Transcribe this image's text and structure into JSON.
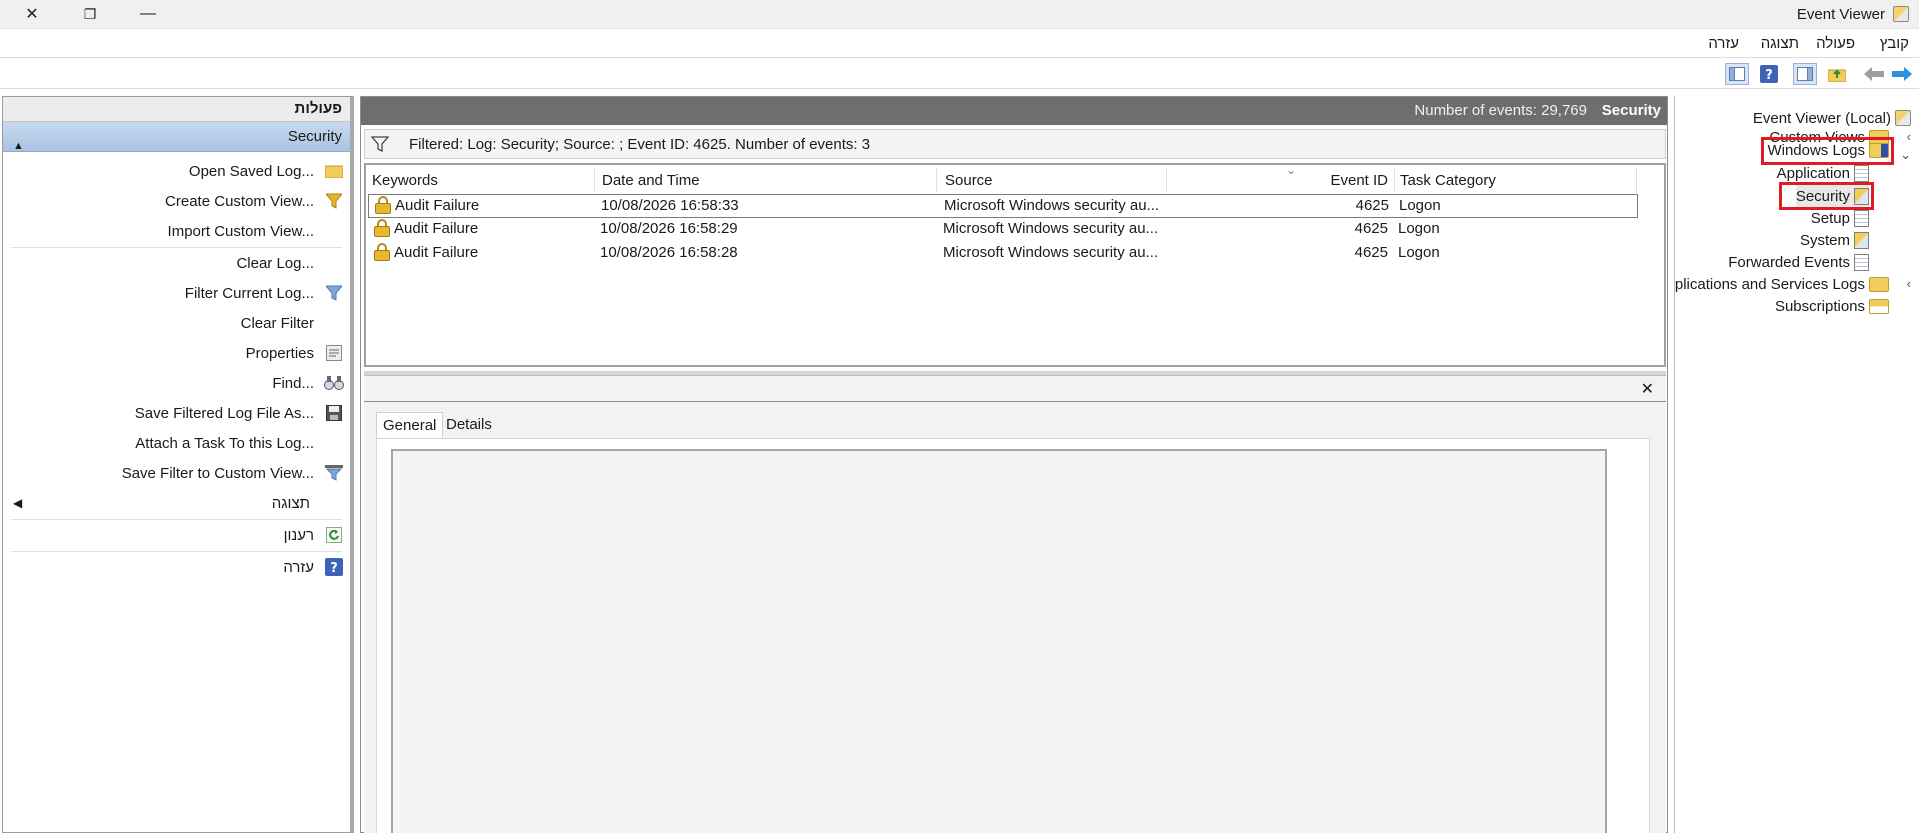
{
  "window": {
    "title": "Event Viewer",
    "close_symbol": "✕",
    "restore_symbol": "❐",
    "minimize_symbol": "—"
  },
  "menu": {
    "items": [
      "קובץ",
      "פעולה",
      "תצוגה",
      "עזרה"
    ]
  },
  "toolbar": {
    "forward_icon": "arrow-right-icon",
    "back_icon": "arrow-left-icon"
  },
  "actions_pane": {
    "header": "פעולות",
    "section_title": "Security",
    "items": [
      {
        "label": "Open Saved Log...",
        "icon": "folder-open-icon",
        "glyph": "📂"
      },
      {
        "label": "Create Custom View...",
        "icon": "filter-icon",
        "glyph": "▼"
      },
      {
        "label": "Import Custom View...",
        "icon": "",
        "glyph": ""
      },
      {
        "label": "Clear Log...",
        "icon": "",
        "glyph": ""
      },
      {
        "label": "Filter Current Log...",
        "icon": "filter-icon",
        "glyph": "▼"
      },
      {
        "label": "Clear Filter",
        "icon": "",
        "glyph": ""
      },
      {
        "label": "Properties",
        "icon": "properties-icon",
        "glyph": "▤"
      },
      {
        "label": "Find...",
        "icon": "binoculars-icon",
        "glyph": "⌕"
      },
      {
        "label": "Save Filtered Log File As...",
        "icon": "save-icon",
        "glyph": "🖫"
      },
      {
        "label": "Attach a Task To this Log...",
        "icon": "",
        "glyph": ""
      },
      {
        "label": "Save Filter to Custom View...",
        "icon": "filter-save-icon",
        "glyph": "⏷"
      }
    ],
    "view_item": "תצוגה",
    "refresh_item": "רענון",
    "help_item": "עזרה"
  },
  "center": {
    "title": "Security",
    "event_count": "Number of events: 29,769",
    "filter_text": "Filtered: Log: Security; Source: ; Event ID: 4625. Number of events: 3",
    "columns": [
      "Keywords",
      "Date and Time",
      "Source",
      "Event ID",
      "Task Category"
    ],
    "rows": [
      {
        "keywords": "Audit Failure",
        "datetime": "10/08/2026 16:58:33",
        "source": "Microsoft Windows security au...",
        "event_id": "4625",
        "task_category": "Logon"
      },
      {
        "keywords": "Audit Failure",
        "datetime": "10/08/2026 16:58:29",
        "source": "Microsoft Windows security au...",
        "event_id": "4625",
        "task_category": "Logon"
      },
      {
        "keywords": "Audit Failure",
        "datetime": "10/08/2026 16:58:28",
        "source": "Microsoft Windows security au...",
        "event_id": "4625",
        "task_category": "Logon"
      }
    ],
    "tabs": [
      "General",
      "Details"
    ],
    "close_symbol": "✕"
  },
  "tree": {
    "root": "Event Viewer (Local)",
    "custom_views": "Custom Views",
    "windows_logs": "Windows Logs",
    "application": "Application",
    "security": "Security",
    "setup": "Setup",
    "system": "System",
    "forwarded_events": "Forwarded Events",
    "apps_services": "Applications and Services Logs",
    "subscriptions": "Subscriptions"
  },
  "colors": {
    "highlight": "#e11b22",
    "section_blue": "#b8cfe9",
    "header_gray": "#6e6e6e"
  }
}
